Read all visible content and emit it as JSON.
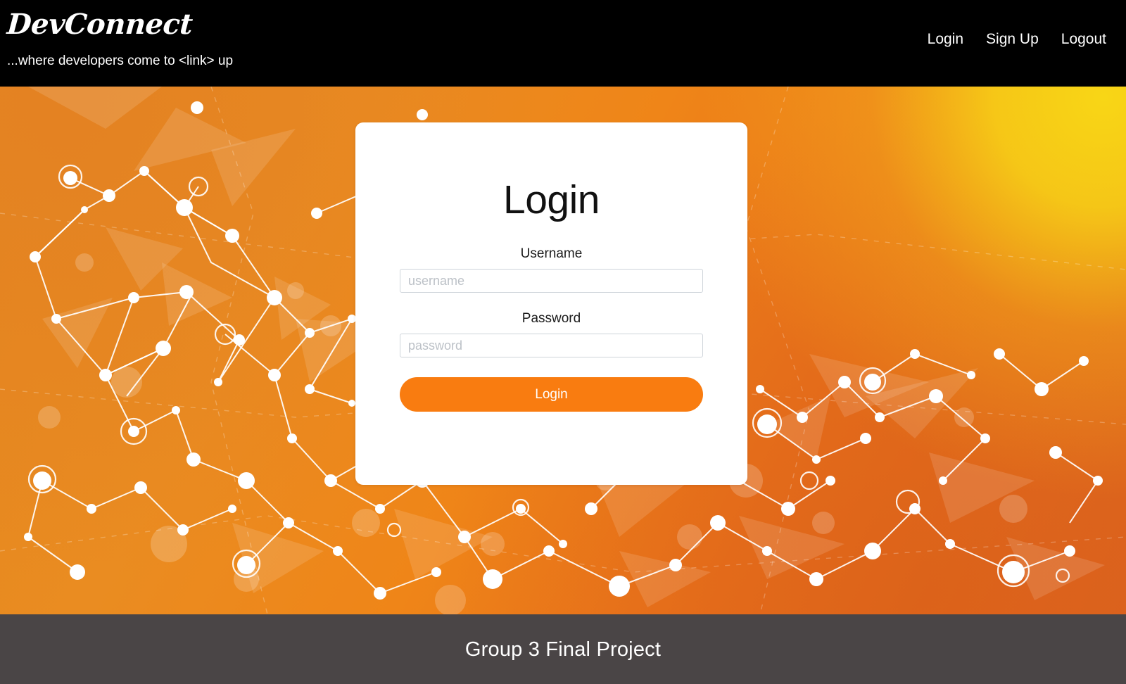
{
  "header": {
    "brand": "DevConnect",
    "tagline": "...where developers come to <link> up",
    "nav": [
      {
        "label": "Login",
        "name": "nav-link-login"
      },
      {
        "label": "Sign Up",
        "name": "nav-link-signup"
      },
      {
        "label": "Logout",
        "name": "nav-link-logout"
      }
    ],
    "background_color": "#000000"
  },
  "login_card": {
    "title": "Login",
    "username": {
      "label": "Username",
      "placeholder": "username",
      "value": ""
    },
    "password": {
      "label": "Password",
      "placeholder": "password",
      "value": ""
    },
    "submit_label": "Login",
    "card_background": "#ffffff",
    "accent_color": "#f97c10"
  },
  "hero": {
    "background_description": "orange-to-yellow polygonal network graphic with white nodes and links",
    "gradient_from": "#e4871f",
    "gradient_highlight": "#f8d616",
    "gradient_to": "#dd641f"
  },
  "footer": {
    "text": "Group 3 Final Project",
    "background_color": "#4a4546",
    "text_color": "#ffffff"
  }
}
